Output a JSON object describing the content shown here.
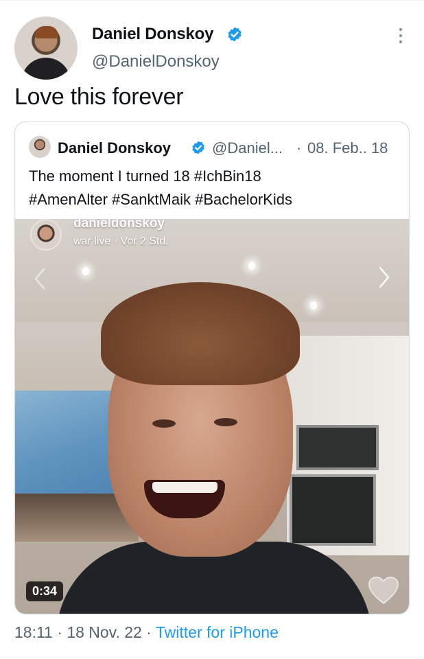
{
  "tweet": {
    "author_name": "Daniel Donskoy",
    "author_handle": "@DanielDonskoy",
    "text": "Love this forever",
    "time": "18:11",
    "separator": "·",
    "date": "18 Nov. 22",
    "source": "Twitter for iPhone",
    "verified_icon": "verified-badge-icon",
    "more_icon": "more-vertical-icon",
    "accent_color": "#1d9bf0"
  },
  "quote": {
    "author_name": "Daniel Donskoy",
    "author_handle": "@Daniel...",
    "separator": "·",
    "date": "08. Feb.. 18",
    "text_line1": "The moment I turned 18  #IchBin18",
    "text_line2": "#AmenAlter #SanktMaik #BachelorKids"
  },
  "video": {
    "overlay_username": "danieldonskoy",
    "overlay_status": "war live · Vor 2 Std.",
    "duration": "0:34"
  }
}
